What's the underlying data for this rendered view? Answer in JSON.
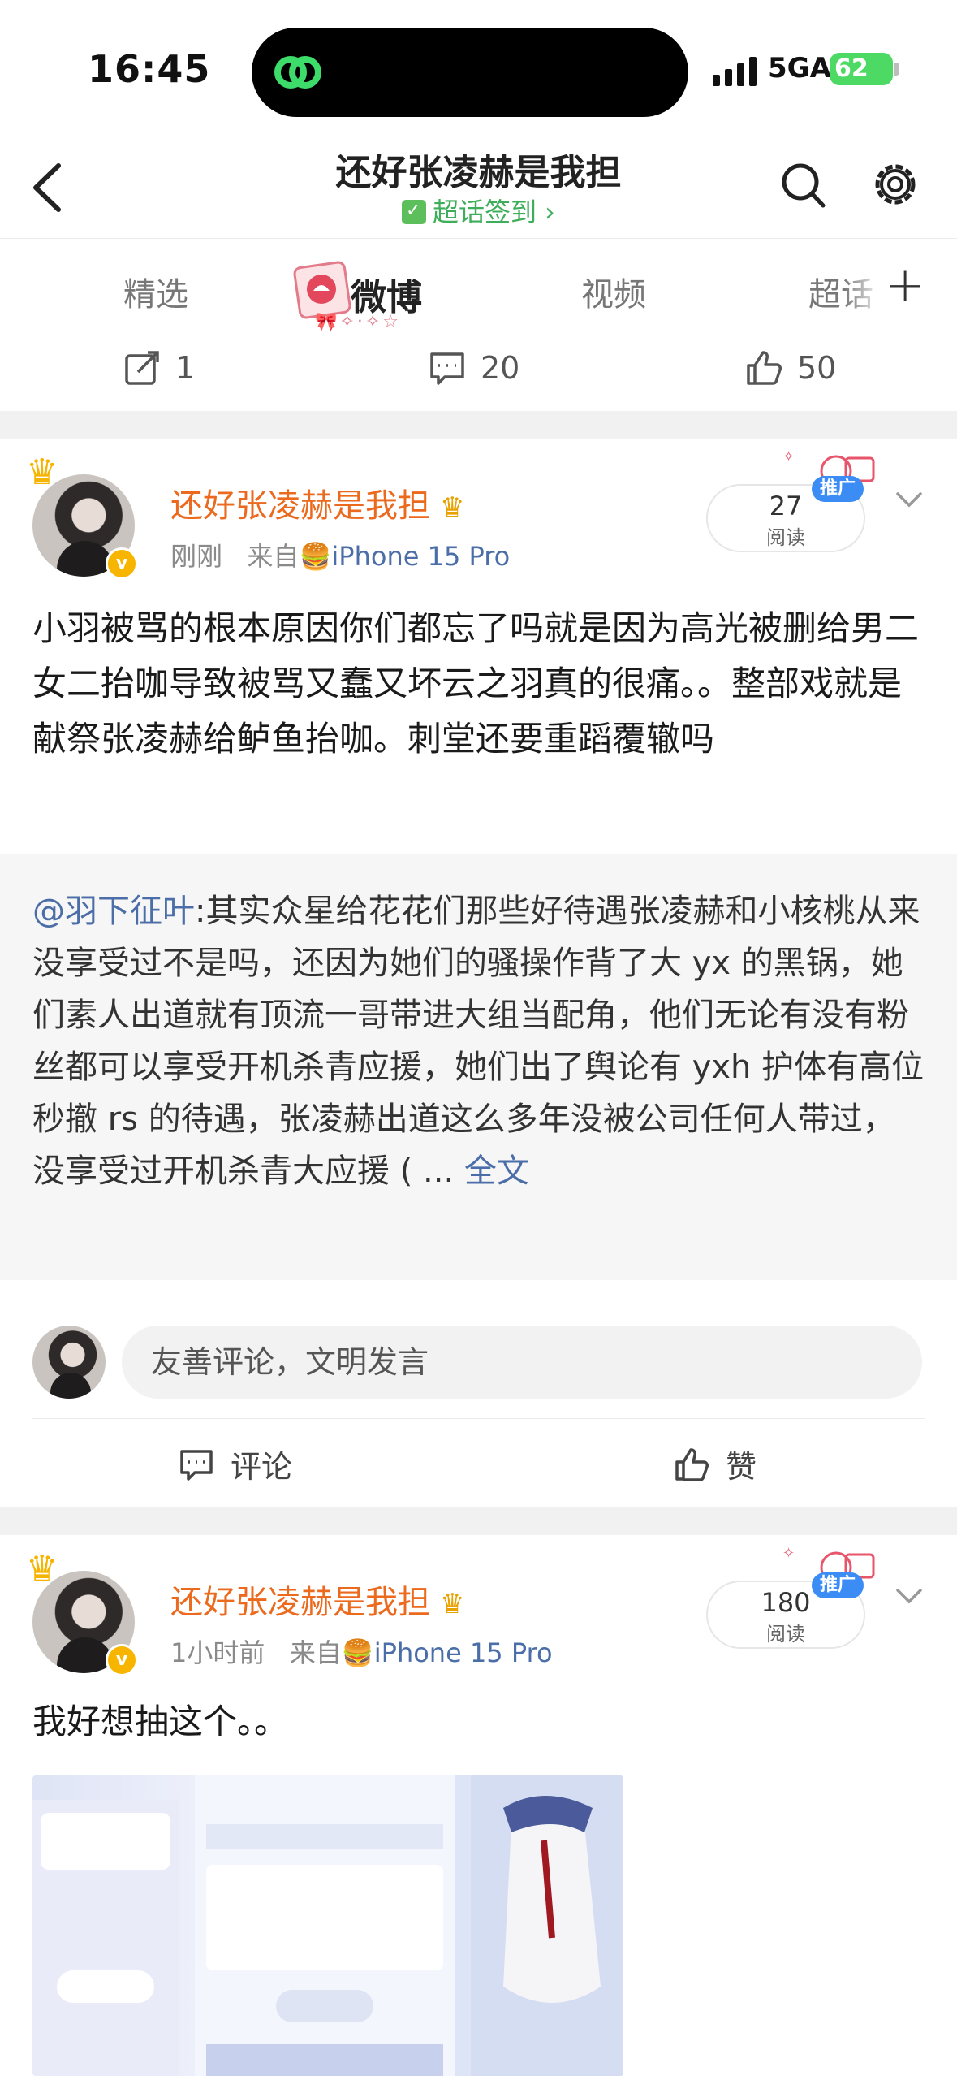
{
  "status_bar": {
    "time": "16:45",
    "network": "5GA",
    "battery": "62"
  },
  "header": {
    "title": "还好张凌赫是我担",
    "signin_label": "超话签到 ›"
  },
  "tabs": [
    {
      "label": "精选"
    },
    {
      "label": "微博"
    },
    {
      "label": "视频"
    },
    {
      "label": "超话"
    }
  ],
  "prev_post_actions": {
    "repost_count": "1",
    "comment_count": "20",
    "like_count": "50"
  },
  "post1": {
    "author": "还好张凌赫是我担",
    "time": "刚刚",
    "from_label": "来自",
    "device": "iPhone 15 Pro",
    "read_count": "27",
    "read_label": "阅读",
    "promo_label": "推广",
    "text": "小羽被骂的根本原因你们都忘了吗就是因为高光被删给男二女二抬咖导致被骂又蠢又坏云之羽真的很痛。。整部戏就是献祭张凌赫给鲈鱼抬咖。刺堂还要重蹈覆辙吗",
    "repost": {
      "at_user": "@羽下征叶",
      "text": ":其实众星给花花们那些好待遇张凌赫和小核桃从来没享受过不是吗，还因为她们的骚操作背了大 yx 的黑锅，她们素人出道就有顶流一哥带进大组当配角，他们无论有没有粉丝都可以享受开机杀青应援，她们出了舆论有 yxh 护体有高位秒撤 rs 的待遇，张凌赫出道这么多年没被公司任何人带过，没享受过开机杀青大应援 ( ... ",
      "full_label": "全文"
    },
    "comment_placeholder": "友善评论，文明发言",
    "comment_label": "评论",
    "like_label": "赞"
  },
  "post2": {
    "author": "还好张凌赫是我担",
    "time": "1小时前",
    "from_label": "来自",
    "device": "iPhone 15 Pro",
    "read_count": "180",
    "read_label": "阅读",
    "promo_label": "推广",
    "text": "我好想抽这个。。"
  }
}
